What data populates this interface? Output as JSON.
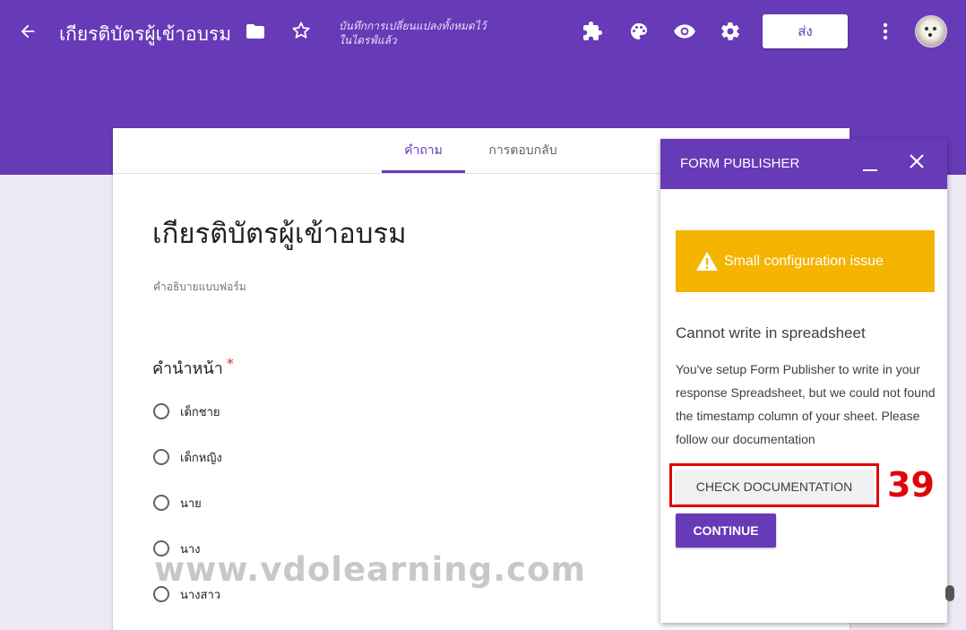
{
  "toolbar": {
    "back_icon": "arrow-left-icon",
    "form_title": "เกียรติบัตรผู้เข้าอบรม",
    "folder_icon": "folder-icon",
    "star_icon": "star-outline-icon",
    "save_status_line1": "บันทึกการเปลี่ยนแปลงทั้งหมดไว้",
    "save_status_line2": "ในไดรฟ์แล้ว",
    "addons_icon": "puzzle-icon",
    "theme_icon": "palette-icon",
    "preview_icon": "eye-icon",
    "settings_icon": "gear-icon",
    "send_label": "ส่ง",
    "more_icon": "more-vertical-icon",
    "avatar": "user-avatar"
  },
  "form": {
    "tabs": [
      {
        "label": "คำถาม",
        "active": true
      },
      {
        "label": "การตอบกลับ",
        "active": false
      }
    ],
    "title": "เกียรติบัตรผู้เข้าอบรม",
    "description_placeholder": "คำอธิบายแบบฟอร์ม",
    "question": {
      "title": "คำนำหน้า",
      "required_mark": "*",
      "options": [
        "เด็กชาย",
        "เด็กหญิง",
        "นาย",
        "นาง",
        "นางสาว"
      ]
    }
  },
  "panel": {
    "title": "FORM PUBLISHER",
    "minimize_icon": "minimize-icon",
    "close_icon": "close-icon",
    "warning_icon": "warning-triangle-icon",
    "warning_text": "Small configuration issue",
    "error_heading": "Cannot write in spreadsheet",
    "error_message": "You've setup Form Publisher to write in your response Spreadsheet, but we could not found the timestamp column of your sheet. Please follow our documentation",
    "check_doc_label": "CHECK DOCUMENTATION",
    "continue_label": "CONTINUE"
  },
  "annotation": {
    "step_number": "39"
  },
  "watermark": "www.vdolearning.com",
  "colors": {
    "brand_purple": "#673ab7",
    "warning_yellow": "#f4b400",
    "annotation_red": "#e0050a",
    "required_red": "#d93025"
  }
}
